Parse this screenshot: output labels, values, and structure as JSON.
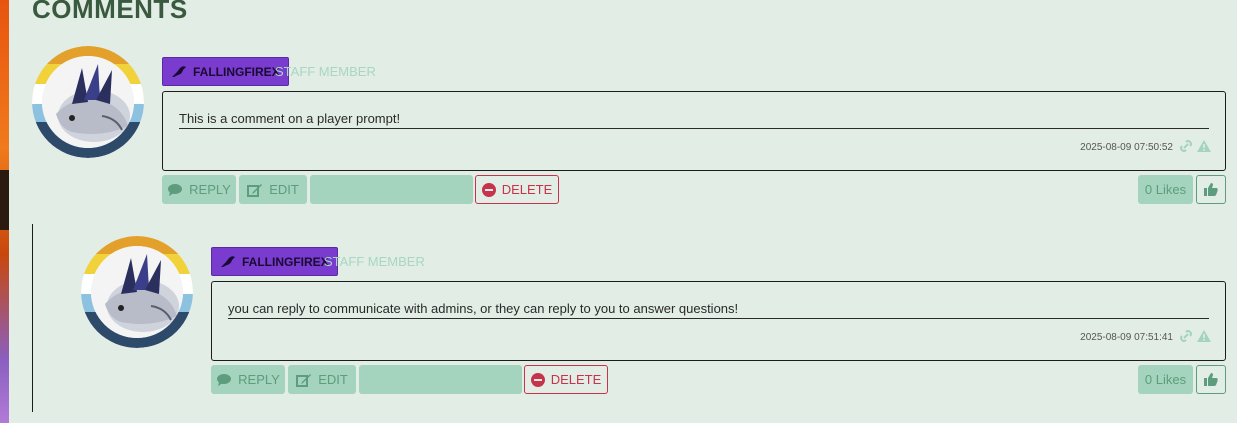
{
  "section": {
    "title": "COMMENTS"
  },
  "comments": [
    {
      "author": "FALLINGFIREX",
      "role": "STAFF MEMBER",
      "text": "This is a comment on a player prompt!",
      "timestamp": "2025-08-09 07:50:52",
      "actions": {
        "reply": "REPLY",
        "edit": "EDIT",
        "delete": "DELETE"
      },
      "likes": "0 Likes"
    },
    {
      "author": "FALLINGFIREX",
      "role": "STAFF MEMBER",
      "text": "you can reply to communicate with admins, or they can reply to you to answer questions!",
      "timestamp": "2025-08-09 07:51:41",
      "actions": {
        "reply": "REPLY",
        "edit": "EDIT",
        "delete": "DELETE"
      },
      "likes": "0 Likes"
    }
  ],
  "colors": {
    "background": "#e2ede5",
    "badge": "#7a3ccf",
    "button_green": "#a4d4bd",
    "delete": "#c8324a",
    "title": "#3a5a3f"
  },
  "icons": {
    "badge": "bird-icon",
    "reply": "comment-icon",
    "edit": "edit-icon",
    "delete": "minus-circle-icon",
    "permalink": "link-icon",
    "report": "warning-icon",
    "like": "thumbs-up-icon"
  }
}
